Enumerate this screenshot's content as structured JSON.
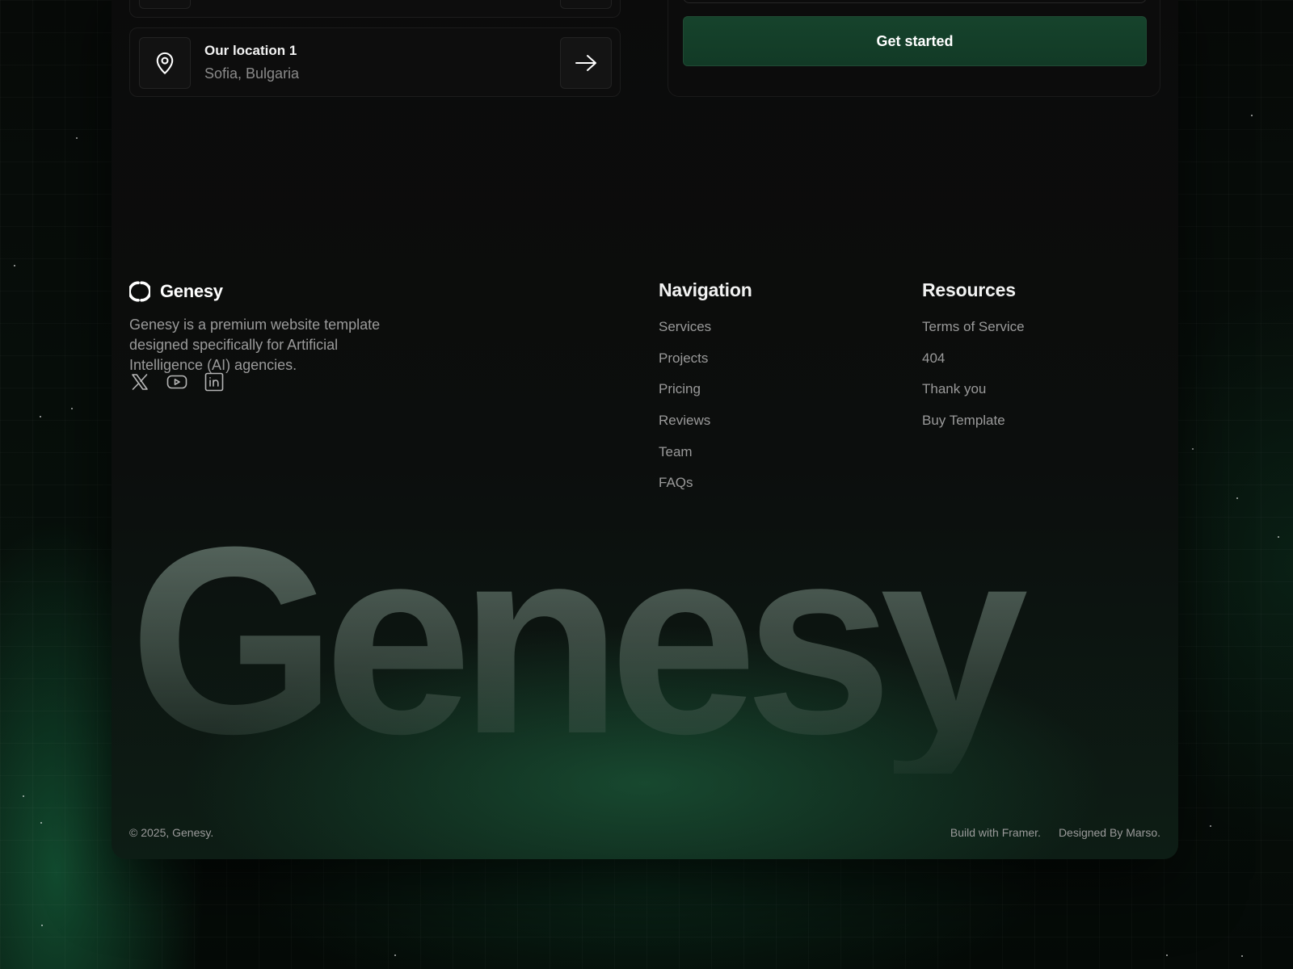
{
  "location_card": {
    "title": "Our location 1",
    "address": "Sofia, Bulgaria",
    "icon": "map-pin-icon",
    "action_icon": "arrow-right-icon"
  },
  "form": {
    "cta_label": "Get started",
    "cta_color": "#143f29"
  },
  "footer": {
    "brand": {
      "name": "Genesy",
      "description": "Genesy is a premium website template designed specifically for Artificial Intelligence (AI) agencies.",
      "logo_icon": "genesy-logo-icon"
    },
    "socials": [
      {
        "icon": "x-icon"
      },
      {
        "icon": "youtube-icon"
      },
      {
        "icon": "linkedin-icon"
      }
    ],
    "navigation": {
      "title": "Navigation",
      "links": [
        "Services",
        "Projects",
        "Pricing",
        "Reviews",
        "Team",
        "FAQs"
      ]
    },
    "resources": {
      "title": "Resources",
      "links": [
        "Terms of Service",
        "404",
        "Thank you",
        "Buy Template"
      ]
    },
    "wordmark": "Genesy",
    "copyright": "© 2025, Genesy.",
    "credits": [
      "Build with Framer.",
      "Designed By Marso."
    ]
  },
  "colors": {
    "background": "#050806",
    "panel": "#0b0b0b",
    "accent_green": "#16432c",
    "muted_text": "#9a9a9a"
  }
}
